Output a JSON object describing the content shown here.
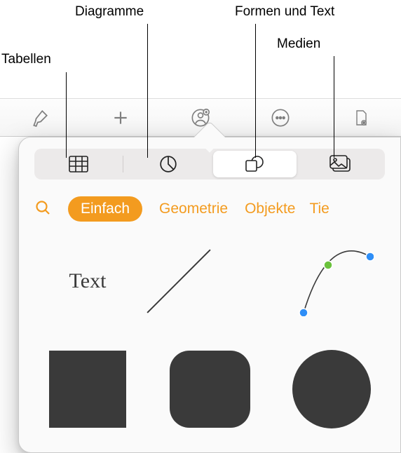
{
  "callouts": {
    "tables": "Tabellen",
    "charts": "Diagramme",
    "shapes_text": "Formen und Text",
    "media": "Medien"
  },
  "segmented": {
    "tables": "table-grid-icon",
    "charts": "pie-chart-icon",
    "shapes": "shape-icon",
    "media": "photo-icon"
  },
  "categories": {
    "search": "search-icon",
    "all": "Einfach",
    "geometry": "Geometrie",
    "objects": "Objekte",
    "animals": "Tie"
  },
  "shapes": {
    "text_label": "Text"
  },
  "toolbar_icons": [
    "brush",
    "plus",
    "add-person",
    "ellipsis",
    "document"
  ]
}
